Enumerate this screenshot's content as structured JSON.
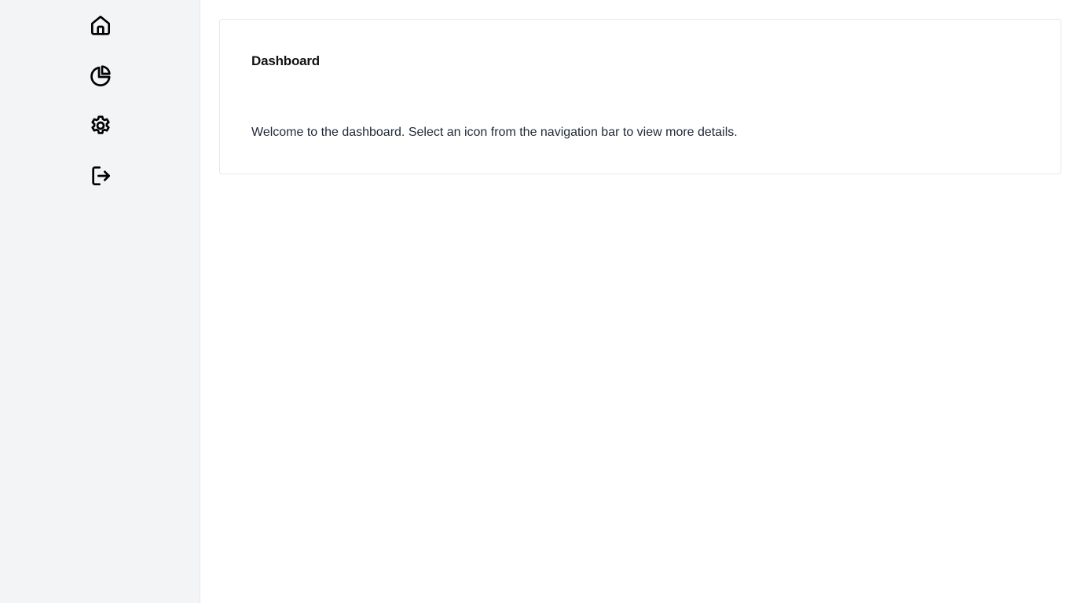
{
  "sidebar": {
    "items": [
      {
        "icon": "home-icon"
      },
      {
        "icon": "pie-chart-icon"
      },
      {
        "icon": "gear-icon"
      },
      {
        "icon": "logout-icon"
      }
    ]
  },
  "main": {
    "card": {
      "title": "Dashboard",
      "text": "Welcome to the dashboard. Select an icon from the navigation bar to view more details."
    }
  },
  "colors": {
    "sidebar_background": "#f3f4f6",
    "card_border": "#e5e7eb",
    "icon_stroke": "#000000"
  }
}
